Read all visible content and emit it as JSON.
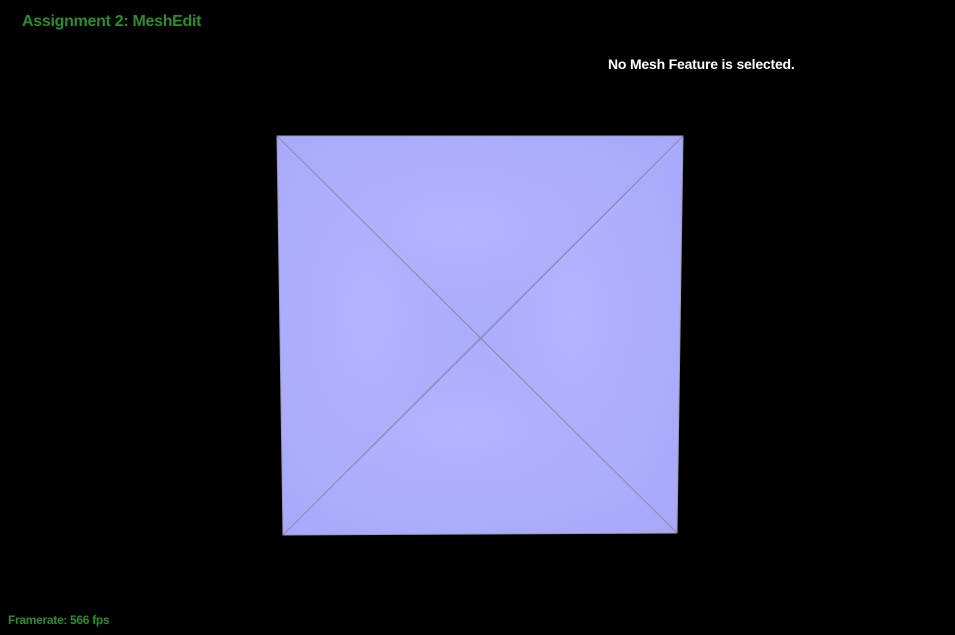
{
  "header": {
    "title": "Assignment 2: MeshEdit"
  },
  "status": {
    "message": "No Mesh Feature is selected."
  },
  "footer": {
    "framerate": "Framerate: 566 fps"
  },
  "colors": {
    "title": "#2e8b2e",
    "status": "#ffffff",
    "framerate": "#2e8b2e",
    "background": "#000000",
    "face": "#b0b0ff",
    "edge": "#8a8aa0"
  }
}
